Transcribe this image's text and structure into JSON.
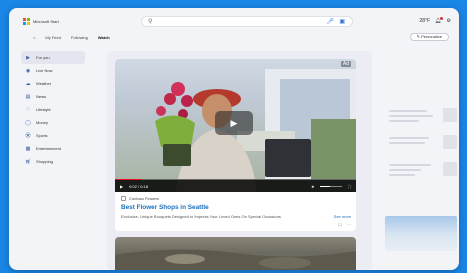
{
  "header": {
    "logo_text": "Microsoft Start",
    "weather": "28°F",
    "ms_colors": [
      "#f25022",
      "#7fba00",
      "#00a4ef",
      "#ffb900"
    ]
  },
  "tabs": [
    {
      "label": "My Feed",
      "active": false
    },
    {
      "label": "Following",
      "active": false
    },
    {
      "label": "Watch",
      "active": true
    }
  ],
  "personalize_label": "Personalize",
  "sidebar": {
    "items": [
      {
        "label": "For you",
        "icon": "for-you-icon",
        "active": true
      },
      {
        "label": "Live Now",
        "icon": "live-icon",
        "active": false
      },
      {
        "label": "Weather",
        "icon": "weather-icon",
        "active": false
      },
      {
        "label": "News",
        "icon": "news-icon",
        "active": false
      },
      {
        "label": "Lifestyle",
        "icon": "lifestyle-icon",
        "active": false
      },
      {
        "label": "Money",
        "icon": "money-icon",
        "active": false
      },
      {
        "label": "Sports",
        "icon": "sports-icon",
        "active": false
      },
      {
        "label": "Entertainment",
        "icon": "entertainment-icon",
        "active": false
      },
      {
        "label": "Shopping",
        "icon": "shopping-icon",
        "active": false
      }
    ]
  },
  "ad": {
    "badge": "Ad",
    "time": "0:02 / 0:18",
    "progress": 0.11,
    "volume": 0.45,
    "sponsor": "Contoso Flowers",
    "title": "Best Flower Shops in Seattle",
    "description": "Exclusive, Unique Bouquets Designed to Impress Your Loved Ones On Special Occasions",
    "see_more": "See more"
  },
  "colors": {
    "accent": "#1a6fbe",
    "background": "#1a86e6",
    "progress": "#e81123"
  }
}
